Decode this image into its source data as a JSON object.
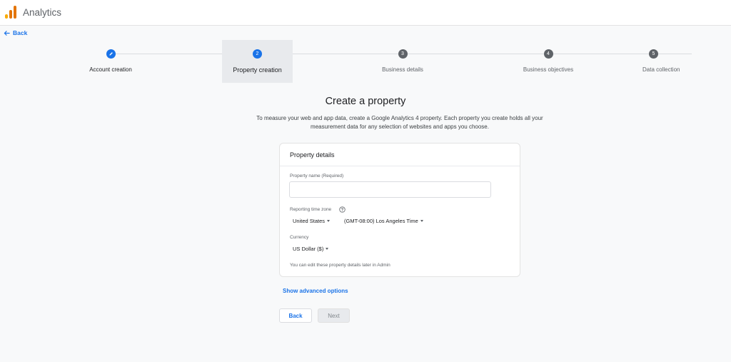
{
  "app": {
    "title": "Analytics",
    "logo_colors": [
      "#f9ab00",
      "#e37400",
      "#e37400"
    ]
  },
  "nav": {
    "back_label": "Back"
  },
  "stepper": {
    "steps": [
      {
        "number": "✎",
        "label": "Account creation",
        "state": "completed"
      },
      {
        "number": "2",
        "label": "Property creation",
        "state": "active"
      },
      {
        "number": "3",
        "label": "Business details",
        "state": "pending"
      },
      {
        "number": "4",
        "label": "Business objectives",
        "state": "pending"
      },
      {
        "number": "5",
        "label": "Data collection",
        "state": "pending"
      }
    ]
  },
  "main": {
    "title": "Create a property",
    "description_line1": "To measure your web and app data, create a Google Analytics 4 property. Each property you create holds all your",
    "description_line2": "measurement data for any selection of websites and apps you choose."
  },
  "card": {
    "title": "Property details",
    "property_name_label": "Property name (Required)",
    "property_name_value": "",
    "timezone_label": "Reporting time zone",
    "country_value": "United States",
    "timezone_value": "(GMT-08:00) Los Angeles Time",
    "currency_label": "Currency",
    "currency_value": "US Dollar ($)",
    "note": "You can edit these property details later in Admin"
  },
  "actions": {
    "advanced_options": "Show advanced options",
    "back_button": "Back",
    "next_button": "Next"
  },
  "colors": {
    "accent": "#1a73e8",
    "pending_step": "#5f6368"
  }
}
